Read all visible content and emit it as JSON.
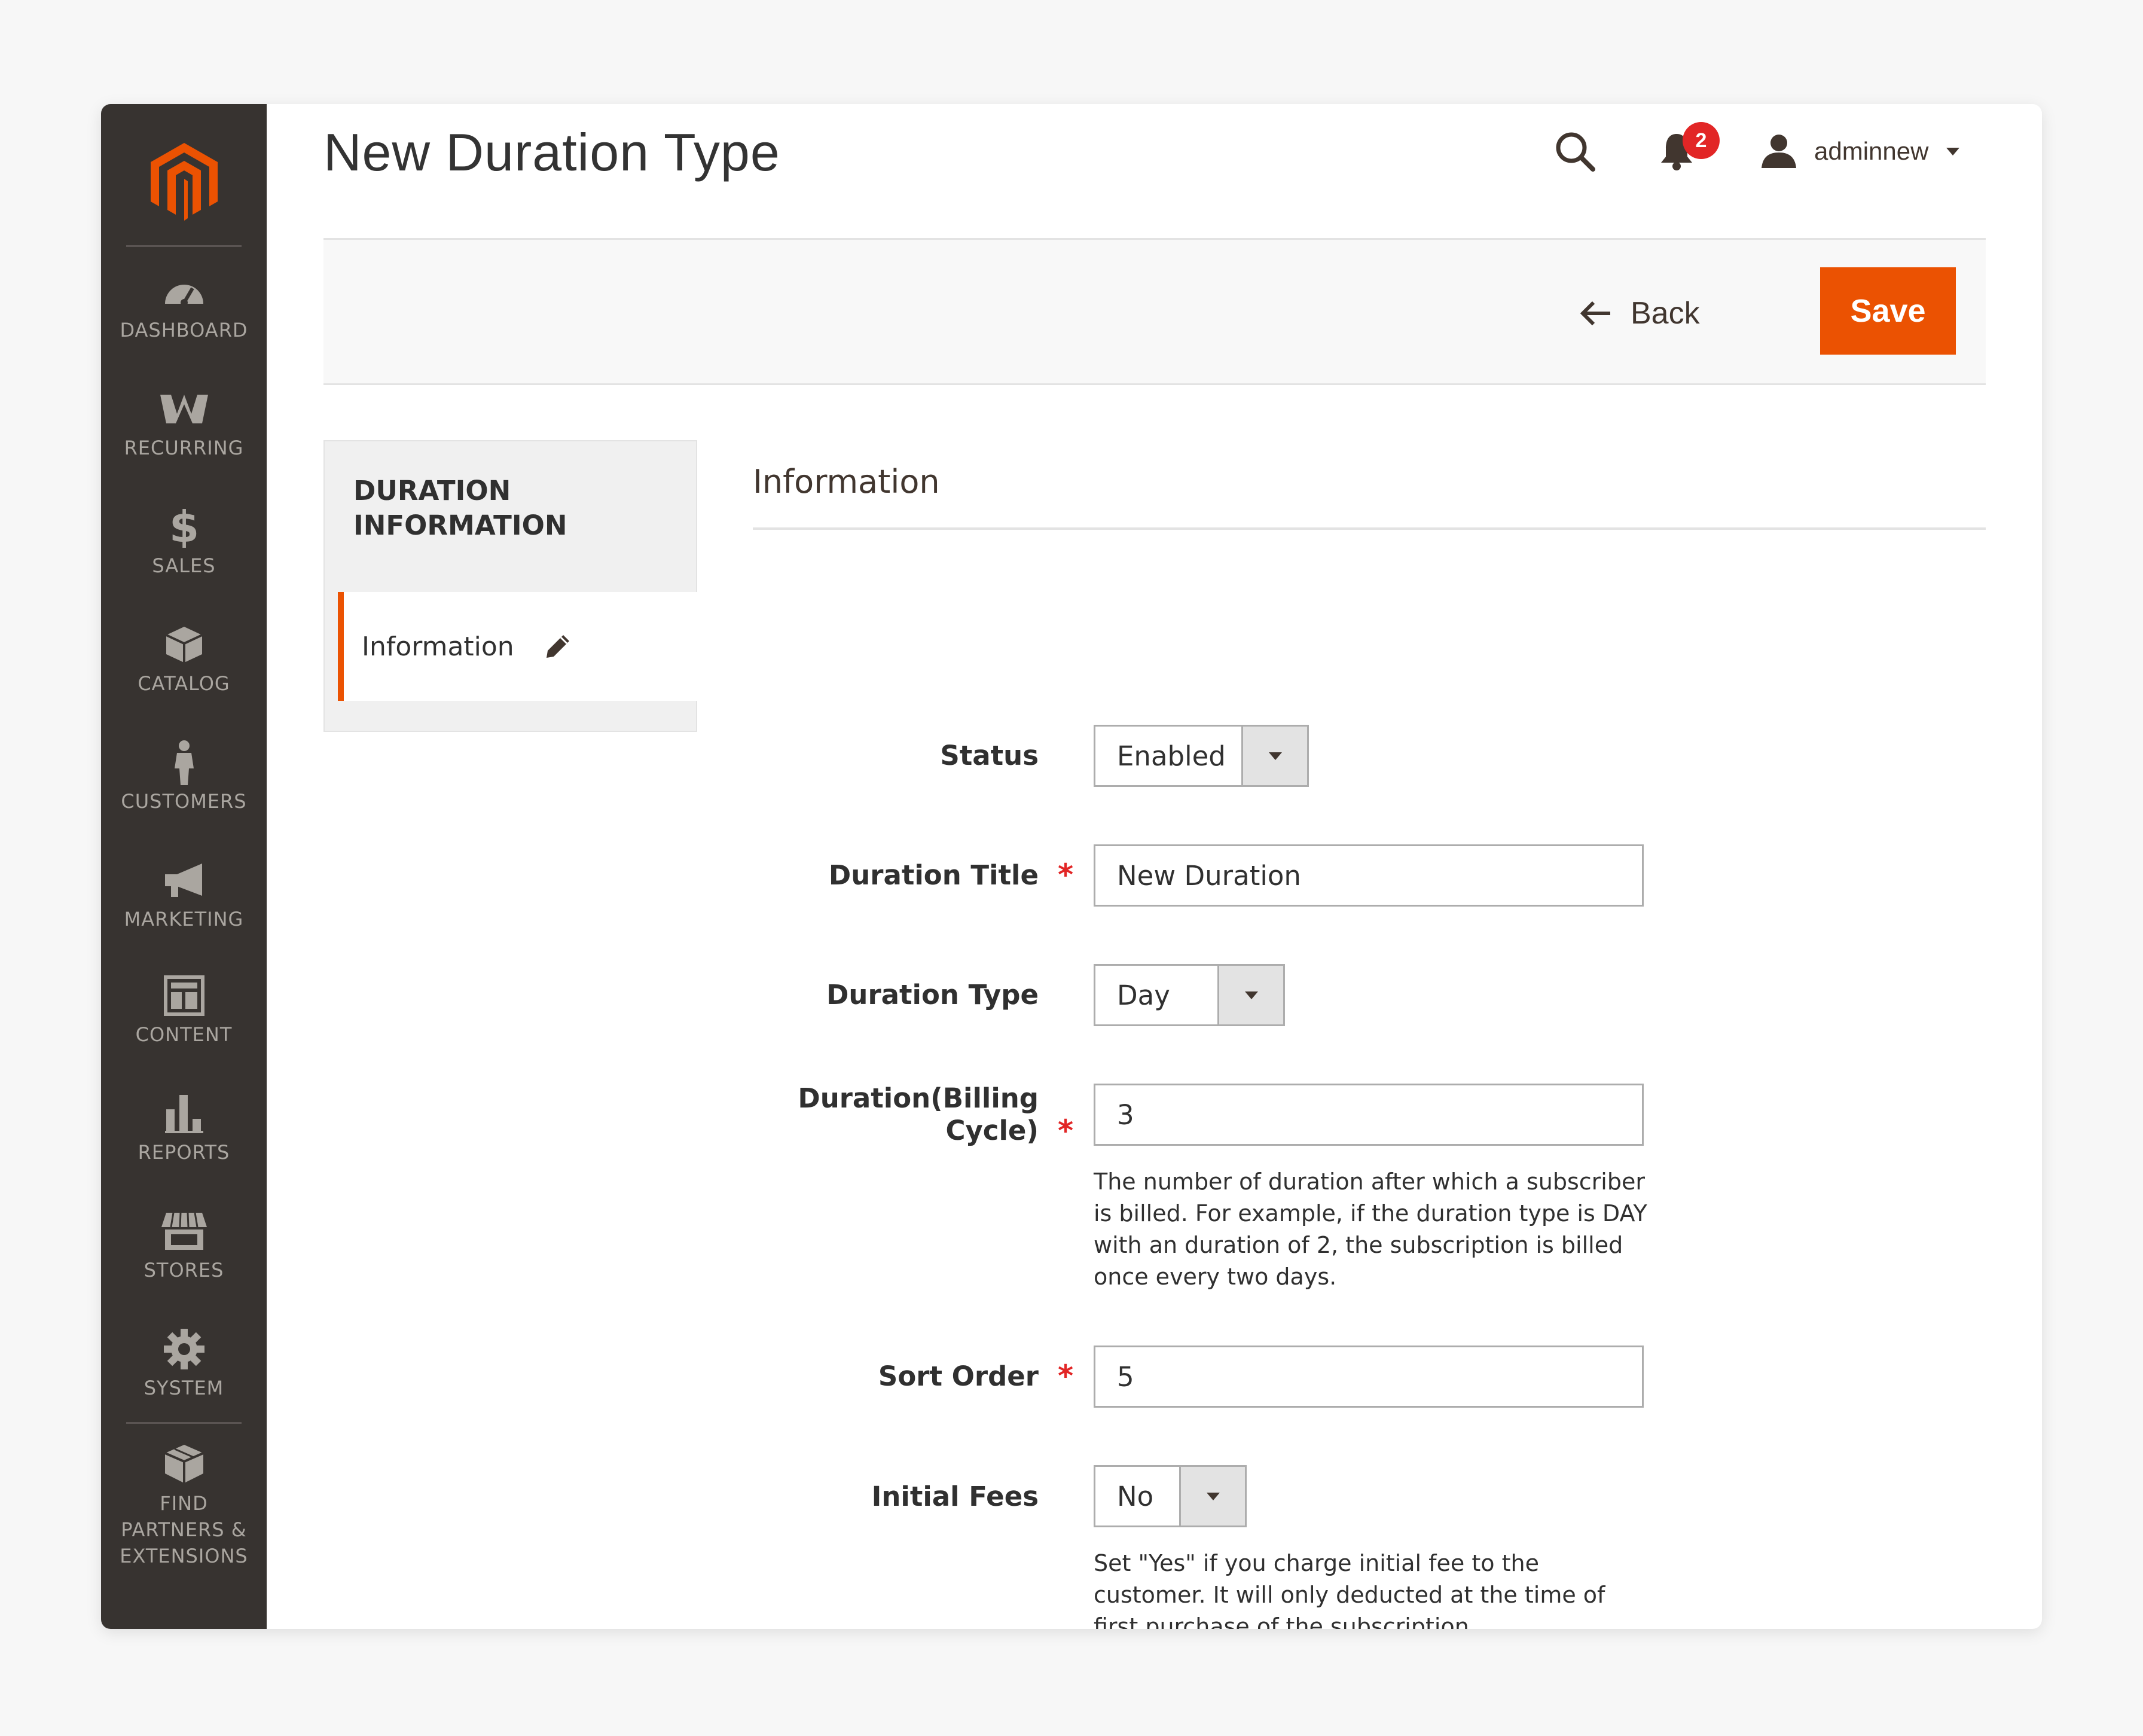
{
  "colors": {
    "accent": "#eb5202",
    "nav_bg": "#373330",
    "nav_text": "#aaa6a0",
    "required": "#e22626",
    "badge": "#e22626"
  },
  "nav": {
    "items": [
      {
        "label": "DASHBOARD",
        "icon": "dashboard-gauge-icon"
      },
      {
        "label": "RECURRING",
        "icon": "recurring-icon"
      },
      {
        "label": "SALES",
        "icon": "dollar-icon"
      },
      {
        "label": "CATALOG",
        "icon": "box-icon"
      },
      {
        "label": "CUSTOMERS",
        "icon": "person-icon"
      },
      {
        "label": "MARKETING",
        "icon": "megaphone-icon"
      },
      {
        "label": "CONTENT",
        "icon": "layout-icon"
      },
      {
        "label": "REPORTS",
        "icon": "bar-chart-icon"
      },
      {
        "label": "STORES",
        "icon": "storefront-icon"
      },
      {
        "label": "SYSTEM",
        "icon": "gear-icon"
      },
      {
        "label": "FIND PARTNERS & EXTENSIONS",
        "icon": "cubes-icon"
      }
    ]
  },
  "header": {
    "title": "New Duration Type",
    "notifications_count": "2",
    "username": "adminnew"
  },
  "actions": {
    "back_label": "Back",
    "save_label": "Save"
  },
  "tabs": {
    "title": "DURATION INFORMATION",
    "items": [
      {
        "label": "Information",
        "active": true
      }
    ]
  },
  "form": {
    "section_title": "Information",
    "status": {
      "label": "Status",
      "value": "Enabled"
    },
    "duration_title": {
      "label": "Duration Title",
      "value": "New Duration",
      "required": "*"
    },
    "duration_type": {
      "label": "Duration Type",
      "value": "Day"
    },
    "billing_cycle": {
      "label_line1": "Duration(Billing",
      "label_line2": "Cycle)",
      "value": "3",
      "required": "*",
      "note": "The number of duration after which a subscriber is billed. For example, if the duration type is DAY with an duration of 2, the subscription is billed once every two days."
    },
    "sort_order": {
      "label": "Sort Order",
      "value": "5",
      "required": "*"
    },
    "initial_fees": {
      "label": "Initial Fees",
      "value": "No",
      "note": "Set \"Yes\" if you charge initial fee to the customer. It will only deducted at the time of first purchase of the subscription."
    }
  }
}
